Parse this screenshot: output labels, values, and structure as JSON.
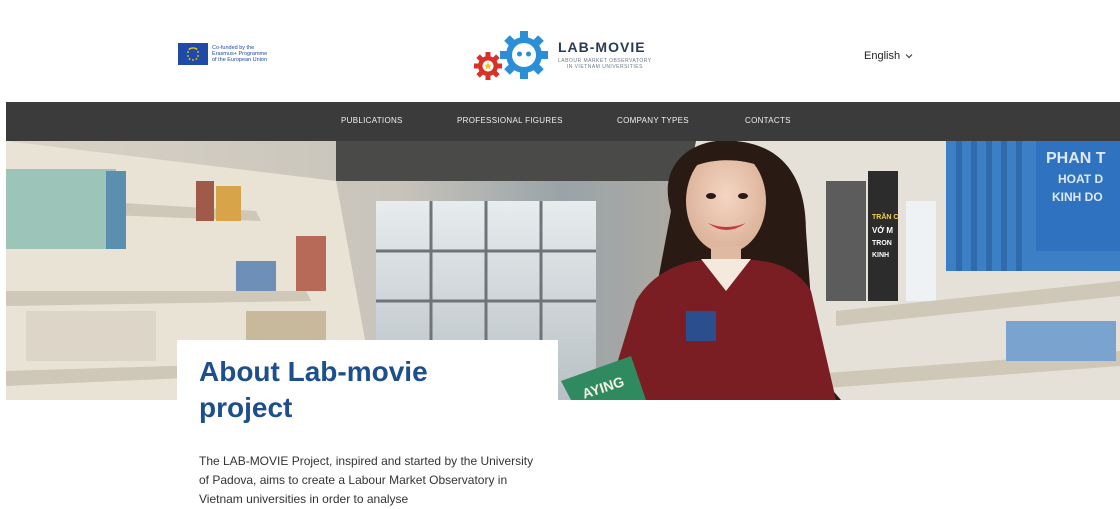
{
  "header": {
    "eu": {
      "line1": "Co-funded by the",
      "line2": "Erasmus+ Programme",
      "line3": "of the European Union"
    },
    "brand": {
      "name": "LAB-MOVIE",
      "sub1": "LABOUR MARKET OBSERVATORY",
      "sub2": "IN VIETNAM UNIVERSITIES"
    },
    "language": {
      "label": "English",
      "icon": "chevron-down-icon"
    }
  },
  "nav": {
    "items": [
      {
        "label": "PUBLICATIONS"
      },
      {
        "label": "PROFESSIONAL FIGURES"
      },
      {
        "label": "COMPANY TYPES"
      },
      {
        "label": "CONTACTS"
      }
    ]
  },
  "hero": {
    "book_cover_text": "PHAN T\nHOAT D\nKINH DO",
    "book_held_text": "AYING",
    "spine1": "TRẦN C\nVỚ M\nTRON\nKINH"
  },
  "about": {
    "title": "About Lab-movie project",
    "body": "The LAB-MOVIE Project, inspired and started by the University of Padova, aims to create a Labour Market Observatory in Vietnam universities in order to analyse"
  },
  "colors": {
    "nav_bg": "#3b3b3b",
    "title_blue": "#1d4f8c",
    "brand_blue": "#2a8fd6",
    "brand_red": "#d6322a"
  }
}
